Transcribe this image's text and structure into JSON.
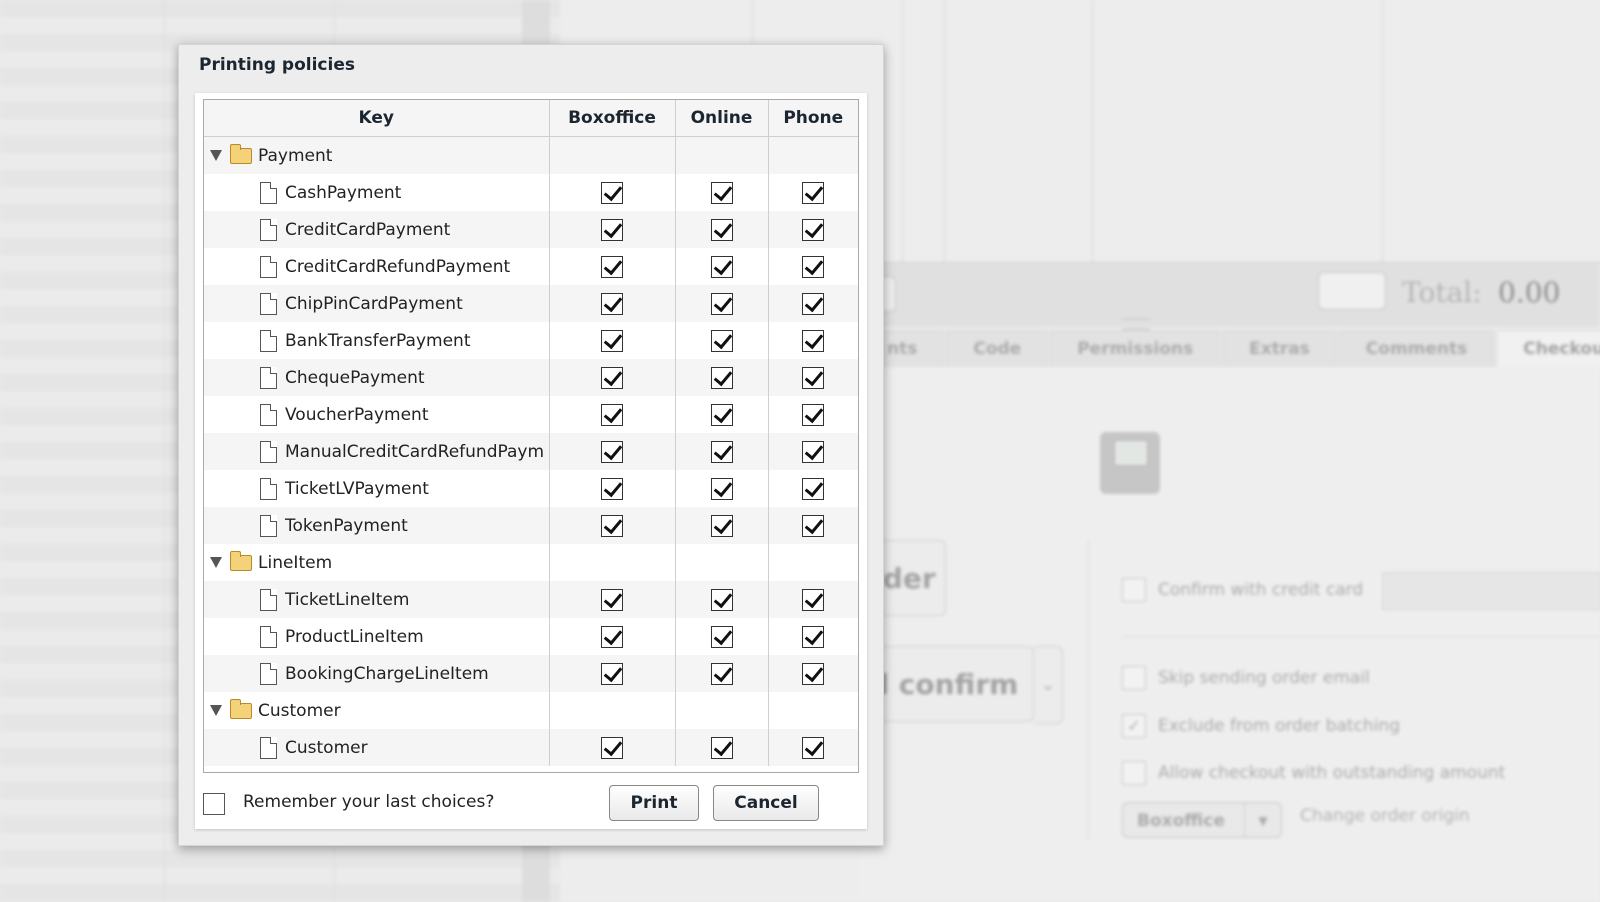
{
  "dialog": {
    "title": "Printing policies",
    "columns": [
      "Key",
      "Boxoffice",
      "Online",
      "Phone"
    ],
    "remember_label": "Remember your last choices?",
    "remember_checked": false,
    "print_label": "Print",
    "cancel_label": "Cancel"
  },
  "tree": [
    {
      "type": "group",
      "label": "Payment"
    },
    {
      "type": "item",
      "label": "CashPayment",
      "checks": [
        true,
        true,
        true
      ]
    },
    {
      "type": "item",
      "label": "CreditCardPayment",
      "checks": [
        true,
        true,
        true
      ]
    },
    {
      "type": "item",
      "label": "CreditCardRefundPayment",
      "checks": [
        true,
        true,
        true
      ]
    },
    {
      "type": "item",
      "label": "ChipPinCardPayment",
      "checks": [
        true,
        true,
        true
      ]
    },
    {
      "type": "item",
      "label": "BankTransferPayment",
      "checks": [
        true,
        true,
        true
      ]
    },
    {
      "type": "item",
      "label": "ChequePayment",
      "checks": [
        true,
        true,
        true
      ]
    },
    {
      "type": "item",
      "label": "VoucherPayment",
      "checks": [
        true,
        true,
        true
      ]
    },
    {
      "type": "item",
      "label": "ManualCreditCardRefundPaym",
      "checks": [
        true,
        true,
        true
      ]
    },
    {
      "type": "item",
      "label": "TicketLVPayment",
      "checks": [
        true,
        true,
        true
      ]
    },
    {
      "type": "item",
      "label": "TokenPayment",
      "checks": [
        true,
        true,
        true
      ]
    },
    {
      "type": "group",
      "label": "LineItem"
    },
    {
      "type": "item",
      "label": "TicketLineItem",
      "checks": [
        true,
        true,
        true
      ]
    },
    {
      "type": "item",
      "label": "ProductLineItem",
      "checks": [
        true,
        true,
        true
      ]
    },
    {
      "type": "item",
      "label": "BookingChargeLineItem",
      "checks": [
        true,
        true,
        true
      ]
    },
    {
      "type": "group",
      "label": "Customer"
    },
    {
      "type": "item",
      "label": "Customer",
      "checks": [
        true,
        true,
        true
      ]
    }
  ],
  "background": {
    "total_label": "Total:",
    "total_value": "0.00",
    "tabs": [
      "nts",
      "Code",
      "Permissions",
      "Extras",
      "Comments",
      "Checkout"
    ],
    "active_tab": "Checkout",
    "order_button": "rder",
    "confirm_button": "d confirm",
    "options": [
      {
        "label": "Confirm with credit card",
        "checked": false
      },
      {
        "label": "Skip sending order email",
        "checked": false
      },
      {
        "label": "Exclude from order batching",
        "checked": true
      },
      {
        "label": "Allow checkout with outstanding amount",
        "checked": false
      }
    ],
    "origin_select": "Boxoffice",
    "origin_label": "Change order origin"
  }
}
